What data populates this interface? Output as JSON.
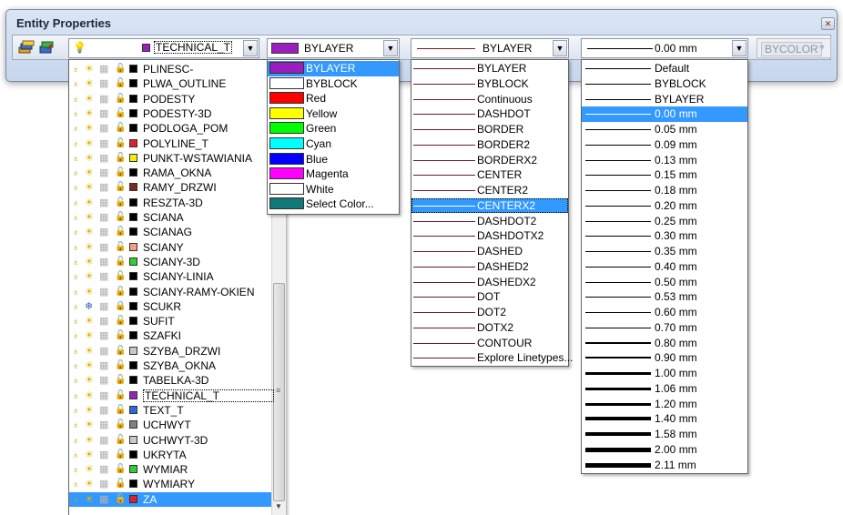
{
  "window": {
    "title": "Entity Properties",
    "close_icon": "close-icon"
  },
  "toolbar": {
    "layer_combo": {
      "value": "TECHNICAL_T",
      "color": "#9b1fbf"
    },
    "color_combo": {
      "value": "BYLAYER",
      "color": "#9b1fbf"
    },
    "linetype_combo": {
      "value": "BYLAYER"
    },
    "lineweight_combo": {
      "value": "0.00 mm"
    },
    "plotstyle_combo": {
      "value": "BYCOLOR"
    }
  },
  "layers": [
    {
      "name": "PLINESC-",
      "color": "#000000",
      "frozen": false,
      "locked": false
    },
    {
      "name": "PLWA_OUTLINE",
      "color": "#000000",
      "frozen": false,
      "locked": false
    },
    {
      "name": "PODESTY",
      "color": "#000000",
      "frozen": false,
      "locked": false
    },
    {
      "name": "PODESTY-3D",
      "color": "#000000",
      "frozen": false,
      "locked": false
    },
    {
      "name": "PODLOGA_POM",
      "color": "#000000",
      "frozen": false,
      "locked": false
    },
    {
      "name": "POLYLINE_T",
      "color": "#e0202a",
      "frozen": false,
      "locked": false
    },
    {
      "name": "PUNKT-WSTAWIANIA",
      "color": "#f0f000",
      "frozen": false,
      "locked": false
    },
    {
      "name": "RAMA_OKNA",
      "color": "#000000",
      "frozen": false,
      "locked": false
    },
    {
      "name": "RAMY_DRZWI",
      "color": "#7a2a1a",
      "frozen": false,
      "locked": false
    },
    {
      "name": "RESZTA-3D",
      "color": "#000000",
      "frozen": false,
      "locked": false
    },
    {
      "name": "SCIANA",
      "color": "#000000",
      "frozen": false,
      "locked": false
    },
    {
      "name": "SCIANAG",
      "color": "#000000",
      "frozen": false,
      "locked": false
    },
    {
      "name": "SCIANY",
      "color": "#f0a080",
      "frozen": false,
      "locked": false
    },
    {
      "name": "SCIANY-3D",
      "color": "#30d030",
      "frozen": false,
      "locked": false
    },
    {
      "name": "SCIANY-LINIA",
      "color": "#000000",
      "frozen": false,
      "locked": false
    },
    {
      "name": "SCIANY-RAMY-OKIEN",
      "color": "#000000",
      "frozen": false,
      "locked": false
    },
    {
      "name": "SCUKR",
      "color": "#000000",
      "frozen": true,
      "locked": true
    },
    {
      "name": "SUFIT",
      "color": "#000000",
      "frozen": false,
      "locked": false
    },
    {
      "name": "SZAFKI",
      "color": "#000000",
      "frozen": false,
      "locked": false
    },
    {
      "name": "SZYBA_DRZWI",
      "color": "#c8c8c8",
      "frozen": false,
      "locked": false
    },
    {
      "name": "SZYBA_OKNA",
      "color": "#000000",
      "frozen": false,
      "locked": false
    },
    {
      "name": "TABELKA-3D",
      "color": "#000000",
      "frozen": false,
      "locked": false
    },
    {
      "name": "TECHNICAL_T",
      "color": "#9b1fbf",
      "frozen": false,
      "locked": false,
      "focus": true
    },
    {
      "name": "TEXT_T",
      "color": "#2a6ae0",
      "frozen": false,
      "locked": false
    },
    {
      "name": "UCHWYT",
      "color": "#808080",
      "frozen": false,
      "locked": false
    },
    {
      "name": "UCHWYT-3D",
      "color": "#c8c8c8",
      "frozen": false,
      "locked": false
    },
    {
      "name": "UKRYTA",
      "color": "#000000",
      "frozen": false,
      "locked": false
    },
    {
      "name": "WYMIAR",
      "color": "#30d030",
      "frozen": false,
      "locked": false
    },
    {
      "name": "WYMIARY",
      "color": "#000000",
      "frozen": false,
      "locked": false
    },
    {
      "name": "ZA",
      "color": "#e0202a",
      "frozen": false,
      "locked": false,
      "selected": true
    }
  ],
  "colors": [
    {
      "name": "BYLAYER",
      "color": "#9b1fbf",
      "selected": true
    },
    {
      "name": "BYBLOCK",
      "color": "#ffffff"
    },
    {
      "name": "Red",
      "color": "#ff0000"
    },
    {
      "name": "Yellow",
      "color": "#ffff00"
    },
    {
      "name": "Green",
      "color": "#00ff00"
    },
    {
      "name": "Cyan",
      "color": "#00ffff"
    },
    {
      "name": "Blue",
      "color": "#0000ff"
    },
    {
      "name": "Magenta",
      "color": "#ff00ff"
    },
    {
      "name": "White",
      "color": "#ffffff"
    },
    {
      "name": "Select Color...",
      "color": "#107878"
    }
  ],
  "linetypes": [
    {
      "name": "BYLAYER"
    },
    {
      "name": "BYBLOCK"
    },
    {
      "name": "Continuous"
    },
    {
      "name": "DASHDOT"
    },
    {
      "name": "BORDER"
    },
    {
      "name": "BORDER2"
    },
    {
      "name": "BORDERX2"
    },
    {
      "name": "CENTER"
    },
    {
      "name": "CENTER2"
    },
    {
      "name": "CENTERX2",
      "selected": true
    },
    {
      "name": "DASHDOT2"
    },
    {
      "name": "DASHDOTX2"
    },
    {
      "name": "DASHED"
    },
    {
      "name": "DASHED2"
    },
    {
      "name": "DASHEDX2"
    },
    {
      "name": "DOT"
    },
    {
      "name": "DOT2"
    },
    {
      "name": "DOTX2"
    },
    {
      "name": "CONTOUR"
    },
    {
      "name": "Explore Linetypes..."
    }
  ],
  "lineweights": [
    {
      "name": "Default",
      "w": 1
    },
    {
      "name": "BYBLOCK",
      "w": 1
    },
    {
      "name": "BYLAYER",
      "w": 1
    },
    {
      "name": "0.00 mm",
      "w": 1,
      "selected": true
    },
    {
      "name": "0.05 mm",
      "w": 1
    },
    {
      "name": "0.09 mm",
      "w": 1
    },
    {
      "name": "0.13 mm",
      "w": 1
    },
    {
      "name": "0.15 mm",
      "w": 1
    },
    {
      "name": "0.18 mm",
      "w": 1
    },
    {
      "name": "0.20 mm",
      "w": 1
    },
    {
      "name": "0.25 mm",
      "w": 1
    },
    {
      "name": "0.30 mm",
      "w": 1
    },
    {
      "name": "0.35 mm",
      "w": 1
    },
    {
      "name": "0.40 mm",
      "w": 1
    },
    {
      "name": "0.50 mm",
      "w": 1
    },
    {
      "name": "0.53 mm",
      "w": 1
    },
    {
      "name": "0.60 mm",
      "w": 1
    },
    {
      "name": "0.70 mm",
      "w": 1.5
    },
    {
      "name": "0.80 mm",
      "w": 2
    },
    {
      "name": "0.90 mm",
      "w": 2
    },
    {
      "name": "1.00 mm",
      "w": 3
    },
    {
      "name": "1.06 mm",
      "w": 3
    },
    {
      "name": "1.20 mm",
      "w": 3
    },
    {
      "name": "1.40 mm",
      "w": 4
    },
    {
      "name": "1.58 mm",
      "w": 4
    },
    {
      "name": "2.00 mm",
      "w": 5
    },
    {
      "name": "2.11 mm",
      "w": 5
    }
  ]
}
